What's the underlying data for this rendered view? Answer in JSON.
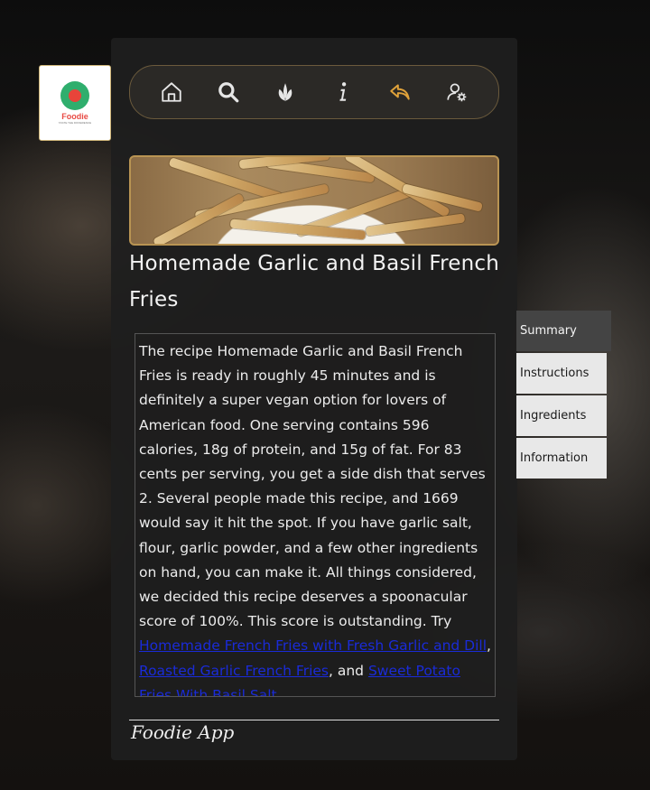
{
  "logo": {
    "brand": "Foodie",
    "tagline": "TASTE THE DIFFERENCE"
  },
  "nav": {
    "icons": [
      "home-icon",
      "search-icon",
      "leaf-icon",
      "info-icon",
      "back-icon",
      "user-settings-icon"
    ],
    "accent": "#e0a23a"
  },
  "recipe": {
    "title": "Homemade Garlic and Basil French Fries",
    "summary_text": "The recipe Homemade Garlic and Basil French Fries is ready in roughly 45 minutes and is definitely a super vegan option for lovers of American food. One serving contains 596 calories, 18g of protein, and 15g of fat. For 83 cents per serving, you get a side dish that serves 2. Several people made this recipe, and 1669 would say it hit the spot. If you have garlic salt, flour, garlic powder, and a few other ingredients on hand, you can make it. All things considered, we decided this recipe deserves a spoonacular score of 100%. This score is outstanding. Try",
    "link1": "Homemade French Fries with Fresh Garlic and Dill",
    "sep1": ",",
    "link2": "Roasted Garlic French Fries",
    "sep2": ", and",
    "link3": "Sweet Potato Fries With Basil Salt"
  },
  "tabs": [
    "Summary",
    "Instructions",
    "Ingredients",
    "Information"
  ],
  "footer": {
    "text": "Foodie App"
  }
}
